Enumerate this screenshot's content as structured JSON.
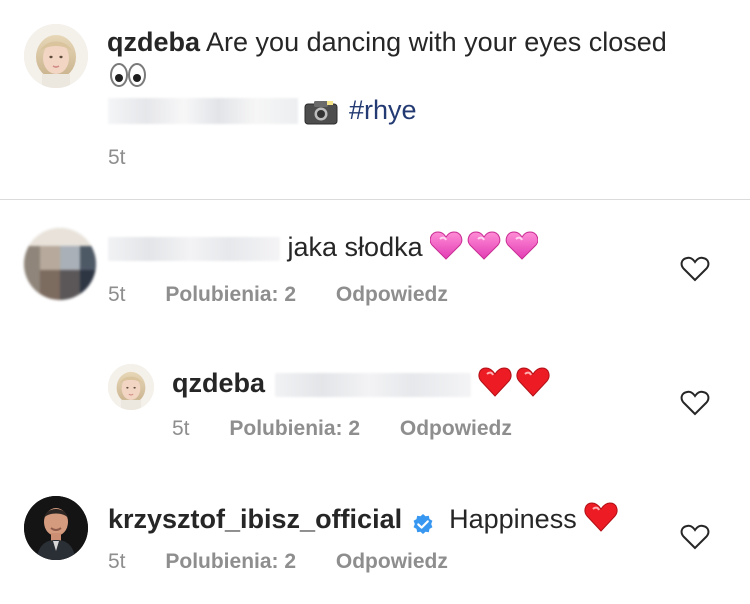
{
  "caption": {
    "username": "qzdeba",
    "text": "Are you dancing with your eyes closed",
    "hashtag": "#rhye",
    "time": "5t"
  },
  "comments": [
    {
      "username": "",
      "text": "jaka słodka",
      "time": "5t",
      "likes": "Polubienia: 2",
      "reply": "Odpowiedz"
    },
    {
      "username": "qzdeba",
      "text": "",
      "time": "5t",
      "likes": "Polubienia: 2",
      "reply": "Odpowiedz"
    },
    {
      "username": "krzysztof_ibisz_official",
      "text": "Happiness",
      "time": "5t",
      "likes": "Polubienia: 2",
      "reply": "Odpowiedz"
    }
  ],
  "colors": {
    "text": "#262626",
    "muted": "#8e8e8e",
    "hashtag": "#233a73",
    "verified": "#3897f0",
    "heart": "#ed1c24"
  },
  "icons": [
    "eyes-icon",
    "camera-icon",
    "heart-outline-icon",
    "verified-icon",
    "red-heart-icon",
    "pink-heart-icon"
  ]
}
